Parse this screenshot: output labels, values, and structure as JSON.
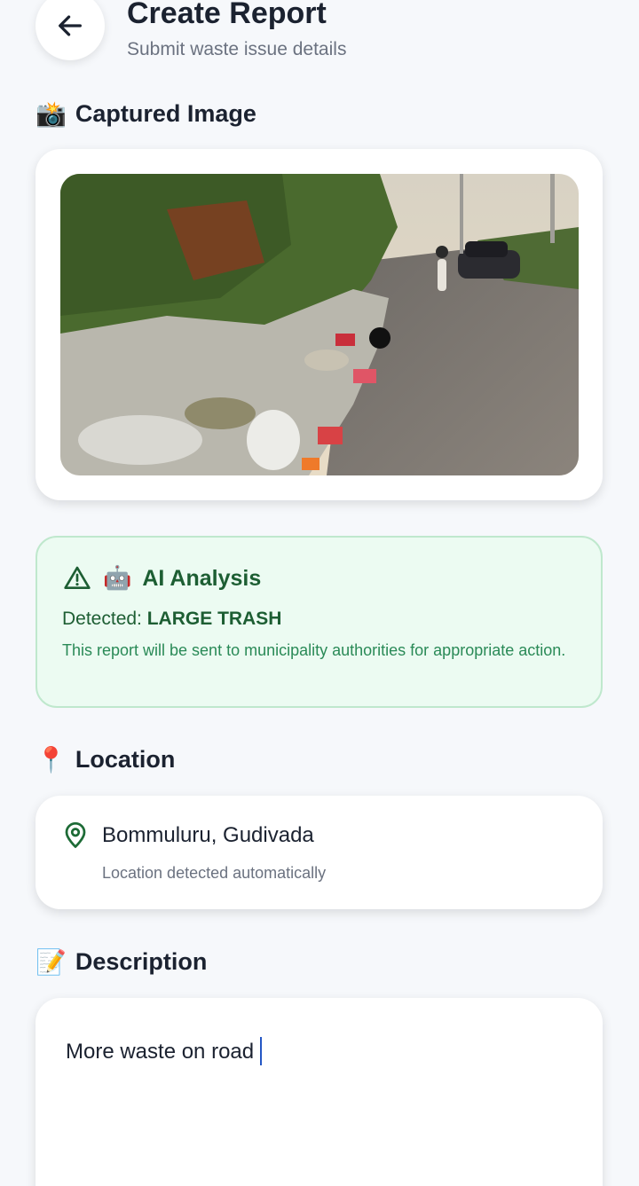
{
  "header": {
    "title": "Create Report",
    "subtitle": "Submit waste issue details",
    "back_icon": "arrow-left-icon"
  },
  "captured_image": {
    "section_emoji": "📸",
    "section_title": "Captured Image",
    "image_alt": "Roadside garbage dump next to a road with vehicles"
  },
  "ai_analysis": {
    "warning_icon": "warning-triangle-icon",
    "robot_emoji": "🤖",
    "title": "AI Analysis",
    "detected_label": "Detected: ",
    "detected_value": "LARGE TRASH",
    "note": "This report will be sent to municipality authorities for appropriate action.",
    "colors": {
      "background": "#ecfbf2",
      "border": "#bfe8cd",
      "text": "#1d5e33",
      "note": "#2a8a57"
    }
  },
  "location": {
    "section_emoji": "📍",
    "section_title": "Location",
    "pin_icon": "map-pin-icon",
    "name": "Bommuluru, Gudivada",
    "status": "Location detected automatically"
  },
  "description": {
    "section_emoji": "📝",
    "section_title": "Description",
    "value": "More waste on road"
  }
}
